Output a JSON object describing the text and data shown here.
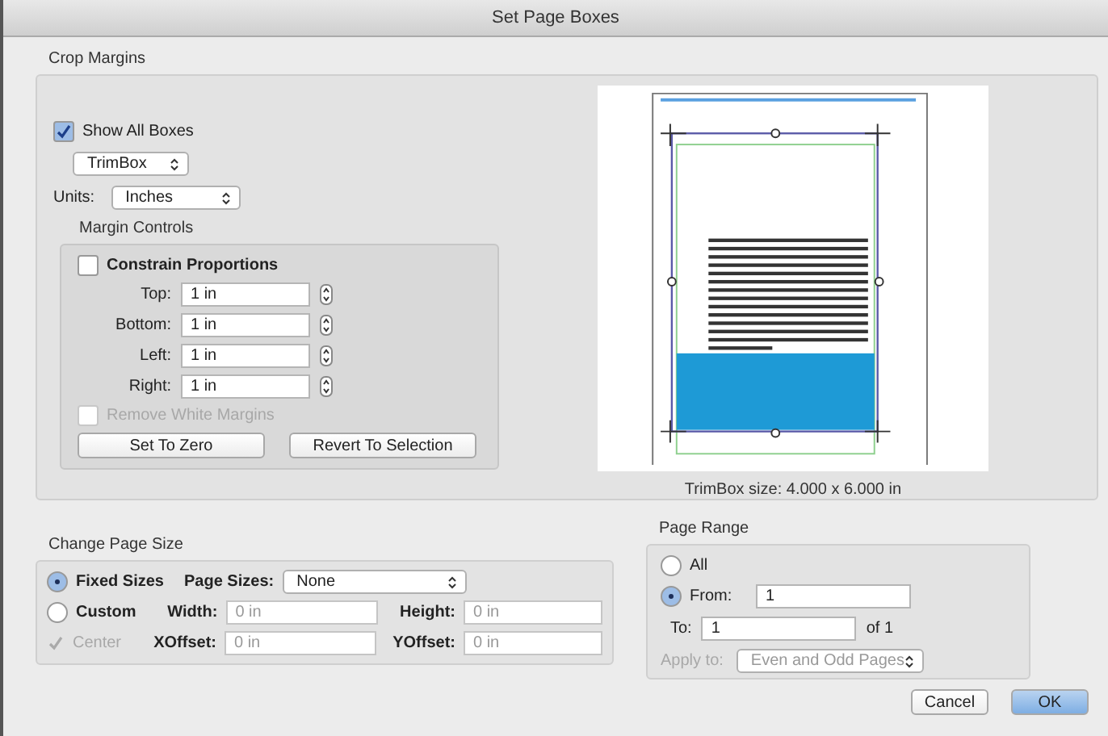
{
  "window": {
    "title": "Set Page Boxes"
  },
  "crop_margins": {
    "title": "Crop Margins",
    "show_all_boxes": {
      "label": "Show All Boxes",
      "checked": true
    },
    "box_select": "TrimBox",
    "units": {
      "label": "Units:",
      "value": "Inches"
    },
    "margin_controls": {
      "title": "Margin Controls",
      "constrain": {
        "label": "Constrain Proportions",
        "checked": false
      },
      "fields": [
        {
          "label": "Top:",
          "value": "1 in"
        },
        {
          "label": "Bottom:",
          "value": "1 in"
        },
        {
          "label": "Left:",
          "value": "1 in"
        },
        {
          "label": "Right:",
          "value": "1 in"
        }
      ],
      "remove_white": {
        "label": "Remove White Margins",
        "checked": false,
        "disabled": true
      },
      "buttons": [
        "Set To Zero",
        "Revert To Selection"
      ]
    },
    "preview": {
      "caption": "TrimBox size: 4.000 x 6.000 in"
    }
  },
  "change_page_size": {
    "title": "Change Page Size",
    "options": [
      {
        "label": "Fixed Sizes",
        "selected": true
      },
      {
        "label": "Custom",
        "selected": false
      }
    ],
    "page_sizes": {
      "label": "Page Sizes:",
      "value": "None"
    },
    "size_fields": [
      {
        "label": "Width:",
        "placeholder": "0 in"
      },
      {
        "label": "Height:",
        "placeholder": "0 in"
      },
      {
        "label": "XOffset:",
        "placeholder": "0 in"
      },
      {
        "label": "YOffset:",
        "placeholder": "0 in"
      }
    ],
    "center": {
      "label": "Center",
      "checked": true,
      "disabled": true
    }
  },
  "page_range": {
    "title": "Page Range",
    "options": [
      {
        "label": "All",
        "selected": false
      },
      {
        "label": "From:",
        "selected": true
      }
    ],
    "from": "1",
    "to": {
      "label": "To:",
      "value": "1"
    },
    "of": "of 1",
    "apply_to": {
      "label": "Apply to:",
      "value": "Even and Odd Pages",
      "disabled": true
    }
  },
  "buttons": [
    {
      "label": "Cancel",
      "default": false
    },
    {
      "label": "OK",
      "default": true
    }
  ]
}
